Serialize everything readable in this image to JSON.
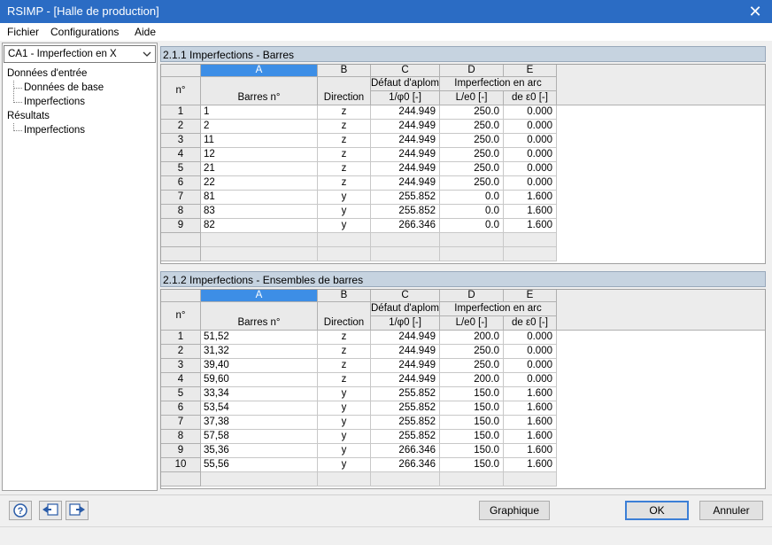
{
  "window": {
    "title": "RSIMP - [Halle de production]",
    "close_glyph": "✕"
  },
  "menu": {
    "items": [
      "Fichier",
      "Configurations",
      "Aide"
    ]
  },
  "case_selector": {
    "value": "CA1 - Imperfection en X"
  },
  "tree": {
    "input_group": "Données d'entrée",
    "base_data": "Données de base",
    "imperfections_input": "Imperfections",
    "results_group": "Résultats",
    "imperfections_result": "Imperfections"
  },
  "table1": {
    "title": "2.1.1 Imperfections - Barres",
    "columns": {
      "n": "n°",
      "A": "A",
      "B": "B",
      "C": "C",
      "D": "D",
      "E": "E"
    },
    "subheaders": {
      "A": "Barres n°",
      "B": "Direction",
      "C1": "Défaut d'aplomb",
      "C2": "1/φ0 [-]",
      "DE1": "Imperfection en arc",
      "D2": "L/e0 [-]",
      "E2": "de ε0 [-]"
    },
    "rows": [
      [
        "1",
        "1",
        "z",
        "244.949",
        "250.0",
        "0.000"
      ],
      [
        "2",
        "2",
        "z",
        "244.949",
        "250.0",
        "0.000"
      ],
      [
        "3",
        "11",
        "z",
        "244.949",
        "250.0",
        "0.000"
      ],
      [
        "4",
        "12",
        "z",
        "244.949",
        "250.0",
        "0.000"
      ],
      [
        "5",
        "21",
        "z",
        "244.949",
        "250.0",
        "0.000"
      ],
      [
        "6",
        "22",
        "z",
        "244.949",
        "250.0",
        "0.000"
      ],
      [
        "7",
        "81",
        "y",
        "255.852",
        "0.0",
        "1.600"
      ],
      [
        "8",
        "83",
        "y",
        "255.852",
        "0.0",
        "1.600"
      ],
      [
        "9",
        "82",
        "y",
        "266.346",
        "0.0",
        "1.600"
      ]
    ]
  },
  "table2": {
    "title": "2.1.2 Imperfections - Ensembles de barres",
    "columns": {
      "n": "n°",
      "A": "A",
      "B": "B",
      "C": "C",
      "D": "D",
      "E": "E"
    },
    "subheaders": {
      "A": "Barres n°",
      "B": "Direction",
      "C1": "Défaut d'aplomb",
      "C2": "1/φ0 [-]",
      "DE1": "Imperfection en arc",
      "D2": "L/e0 [-]",
      "E2": "de ε0 [-]"
    },
    "rows": [
      [
        "1",
        "51,52",
        "z",
        "244.949",
        "200.0",
        "0.000"
      ],
      [
        "2",
        "31,32",
        "z",
        "244.949",
        "250.0",
        "0.000"
      ],
      [
        "3",
        "39,40",
        "z",
        "244.949",
        "250.0",
        "0.000"
      ],
      [
        "4",
        "59,60",
        "z",
        "244.949",
        "200.0",
        "0.000"
      ],
      [
        "5",
        "33,34",
        "y",
        "255.852",
        "150.0",
        "1.600"
      ],
      [
        "6",
        "53,54",
        "y",
        "255.852",
        "150.0",
        "1.600"
      ],
      [
        "7",
        "37,38",
        "y",
        "255.852",
        "150.0",
        "1.600"
      ],
      [
        "8",
        "57,58",
        "y",
        "255.852",
        "150.0",
        "1.600"
      ],
      [
        "9",
        "35,36",
        "y",
        "266.346",
        "150.0",
        "1.600"
      ],
      [
        "10",
        "55,56",
        "y",
        "266.346",
        "150.0",
        "1.600"
      ]
    ]
  },
  "buttons": {
    "graphique": "Graphique",
    "ok": "OK",
    "annuler": "Annuler"
  },
  "icons": {
    "help": "help-icon",
    "import": "import-icon",
    "export": "export-icon"
  },
  "colors": {
    "title_bar": "#2b6cc4",
    "selected_column": "#3d8ee6",
    "section_header": "#c6d3e0"
  }
}
